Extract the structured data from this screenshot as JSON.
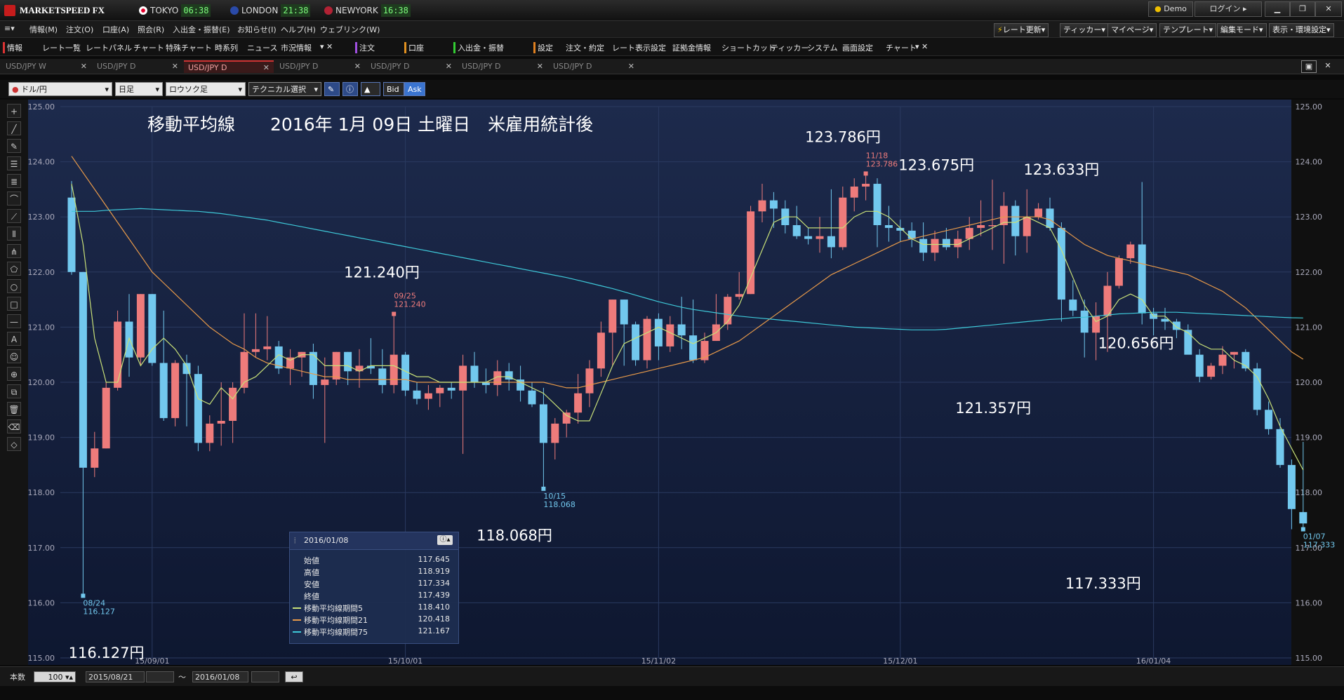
{
  "app": {
    "title": "MARKETSPEED FX"
  },
  "clocks": [
    {
      "city": "TOKYO",
      "time": "06:38",
      "flag": "#e4002b"
    },
    {
      "city": "LONDON",
      "time": "21:38",
      "flag": "#2a4aa8"
    },
    {
      "city": "NEWYORK",
      "time": "16:38",
      "flag": "#b22234"
    }
  ],
  "window": {
    "demo_label": "Demo",
    "login_label": "ログイン"
  },
  "menu": [
    "情報(M)",
    "注文(O)",
    "口座(A)",
    "照会(R)",
    "入出金・振替(E)",
    "お知らせ(I)",
    "ヘルプ(H)",
    "ウェブリンク(W)"
  ],
  "right_buttons": [
    "レート更新",
    "ティッカー",
    "マイページ",
    "テンプレート",
    "編集モード",
    "表示・環境設定"
  ],
  "toolbar": {
    "info_label": "情報",
    "info_items": [
      "レート一覧",
      "レートパネル",
      "チャート",
      "特殊チャート",
      "時系列",
      "ニュース",
      "市況情報"
    ],
    "order_label": "注文",
    "account_label": "口座",
    "deposit_label": "入出金・振替",
    "settings_label": "設定",
    "settings_items": [
      "注文・約定",
      "レート表示設定",
      "証拠金情報",
      "ショートカット",
      "ティッカー",
      "システム",
      "画面設定",
      "チャート"
    ]
  },
  "tabs": [
    "USD/JPY W",
    "USD/JPY D",
    "USD/JPY D",
    "USD/JPY D",
    "USD/JPY D",
    "USD/JPY D",
    "USD/JPY D"
  ],
  "active_tab": 2,
  "chart_controls": {
    "pair": "ドル/円",
    "period": "日足",
    "chart_type": "ロウソク足",
    "technical": "テクニカル選択",
    "bid": "Bid",
    "ask": "Ask"
  },
  "left_tools": [
    "crosshair",
    "trend-line",
    "pencil",
    "horizontal-lines",
    "channel-lines",
    "arc",
    "fibonacci-fan",
    "vertical-lines",
    "pitchfork",
    "pentagon",
    "circle",
    "rectangle",
    "horizontal-line",
    "text",
    "icon",
    "zoom",
    "copy",
    "trash",
    "erase",
    "tag"
  ],
  "footer": {
    "count_label": "本数",
    "count": "100",
    "from": "2015/08/21",
    "tilde": "〜",
    "to": "2016/01/08"
  },
  "chart_data": {
    "type": "candlestick",
    "title": "移動平均線　　2016年 1月 09日 土曜日　米雇用統計後",
    "ylim": [
      115.0,
      125.0
    ],
    "yticks": [
      "125.00",
      "124.00",
      "123.00",
      "122.00",
      "121.00",
      "120.00",
      "119.00",
      "118.00",
      "117.00",
      "116.00",
      "115.00"
    ],
    "x_date_labels": [
      {
        "i": 7,
        "label": "15/09/01"
      },
      {
        "i": 29,
        "label": "15/10/01"
      },
      {
        "i": 51,
        "label": "15/11/02"
      },
      {
        "i": 72,
        "label": "15/12/01"
      },
      {
        "i": 94,
        "label": "16/01/04"
      }
    ],
    "up_color": "#ee7b7b",
    "down_color": "#72c8ee",
    "candles": [
      [
        123.35,
        123.65,
        121.95,
        122.0
      ],
      [
        122.0,
        122.0,
        116.127,
        118.45
      ],
      [
        118.45,
        119.1,
        118.28,
        118.8
      ],
      [
        118.8,
        120.0,
        118.8,
        119.9
      ],
      [
        119.9,
        121.3,
        119.85,
        121.1
      ],
      [
        121.1,
        121.6,
        120.1,
        120.45
      ],
      [
        120.45,
        121.6,
        120.3,
        121.6
      ],
      [
        121.6,
        121.6,
        120.3,
        120.35
      ],
      [
        120.35,
        121.3,
        119.3,
        119.35
      ],
      [
        119.35,
        120.4,
        119.2,
        120.35
      ],
      [
        120.35,
        120.5,
        119.2,
        120.15
      ],
      [
        120.15,
        120.3,
        118.75,
        118.9
      ],
      [
        118.9,
        119.4,
        118.75,
        119.25
      ],
      [
        119.25,
        120.0,
        118.85,
        119.3
      ],
      [
        119.3,
        120.0,
        118.9,
        119.9
      ],
      [
        119.9,
        121.25,
        119.8,
        120.55
      ],
      [
        120.55,
        121.25,
        120.45,
        120.6
      ],
      [
        120.6,
        121.2,
        120.4,
        120.65
      ],
      [
        120.65,
        120.75,
        120.15,
        120.25
      ],
      [
        120.25,
        120.6,
        119.95,
        120.45
      ],
      [
        120.45,
        120.55,
        120.1,
        120.55
      ],
      [
        120.55,
        120.7,
        119.7,
        119.95
      ],
      [
        119.95,
        120.45,
        118.9,
        120.05
      ],
      [
        120.05,
        120.55,
        119.95,
        120.55
      ],
      [
        120.55,
        120.55,
        119.95,
        120.2
      ],
      [
        120.2,
        120.6,
        119.9,
        120.3
      ],
      [
        120.3,
        120.8,
        120.15,
        120.25
      ],
      [
        120.25,
        120.6,
        119.8,
        119.95
      ],
      [
        119.95,
        121.24,
        119.8,
        120.5
      ],
      [
        120.5,
        120.55,
        119.75,
        119.85
      ],
      [
        119.85,
        120.0,
        119.6,
        119.7
      ],
      [
        119.7,
        119.95,
        119.5,
        119.8
      ],
      [
        119.8,
        119.95,
        119.55,
        119.9
      ],
      [
        119.9,
        120.0,
        119.7,
        119.85
      ],
      [
        119.85,
        120.5,
        118.7,
        120.3
      ],
      [
        120.3,
        120.55,
        119.9,
        120.0
      ],
      [
        120.0,
        120.25,
        119.8,
        119.95
      ],
      [
        119.95,
        120.4,
        119.75,
        120.2
      ],
      [
        120.2,
        120.35,
        119.85,
        120.05
      ],
      [
        120.05,
        120.3,
        119.65,
        119.85
      ],
      [
        119.85,
        120.0,
        119.55,
        119.6
      ],
      [
        119.6,
        119.9,
        118.068,
        118.9
      ],
      [
        118.9,
        119.35,
        118.6,
        119.25
      ],
      [
        119.25,
        119.5,
        119.0,
        119.45
      ],
      [
        119.45,
        120.15,
        119.25,
        119.8
      ],
      [
        119.8,
        120.4,
        119.55,
        120.25
      ],
      [
        120.25,
        121.1,
        120.1,
        120.9
      ],
      [
        120.9,
        121.5,
        120.3,
        121.5
      ],
      [
        121.5,
        121.5,
        120.3,
        121.05
      ],
      [
        121.05,
        121.1,
        120.3,
        120.4
      ],
      [
        120.4,
        121.2,
        120.25,
        121.15
      ],
      [
        121.15,
        121.25,
        120.4,
        120.65
      ],
      [
        120.65,
        121.2,
        120.55,
        121.05
      ],
      [
        121.05,
        121.55,
        120.6,
        120.85
      ],
      [
        120.85,
        121.5,
        120.35,
        120.4
      ],
      [
        120.4,
        120.9,
        120.35,
        120.75
      ],
      [
        120.75,
        121.6,
        120.75,
        121.05
      ],
      [
        121.05,
        121.6,
        120.95,
        121.55
      ],
      [
        121.55,
        122.0,
        121.5,
        121.6
      ],
      [
        121.6,
        123.2,
        121.6,
        123.1
      ],
      [
        123.1,
        123.6,
        122.9,
        123.3
      ],
      [
        123.3,
        123.45,
        122.8,
        123.15
      ],
      [
        123.15,
        123.3,
        122.7,
        122.85
      ],
      [
        122.85,
        123.2,
        122.6,
        122.65
      ],
      [
        122.65,
        122.8,
        122.5,
        122.6
      ],
      [
        122.6,
        123.0,
        122.35,
        122.65
      ],
      [
        122.65,
        123.5,
        122.25,
        122.45
      ],
      [
        122.45,
        123.55,
        122.4,
        123.35
      ],
      [
        123.35,
        123.7,
        123.1,
        123.55
      ],
      [
        123.55,
        123.786,
        123.3,
        123.6
      ],
      [
        123.6,
        123.7,
        122.45,
        122.85
      ],
      [
        122.85,
        123.2,
        122.55,
        122.8
      ],
      [
        122.8,
        122.95,
        122.55,
        122.75
      ],
      [
        122.75,
        122.9,
        122.45,
        122.6
      ],
      [
        122.6,
        122.9,
        122.2,
        122.35
      ],
      [
        122.35,
        122.75,
        122.2,
        122.6
      ],
      [
        122.6,
        122.8,
        122.4,
        122.45
      ],
      [
        122.45,
        122.75,
        122.25,
        122.6
      ],
      [
        122.6,
        123.0,
        122.4,
        122.8
      ],
      [
        122.8,
        123.3,
        122.65,
        122.85
      ],
      [
        122.85,
        123.675,
        122.4,
        122.85
      ],
      [
        122.85,
        123.45,
        122.15,
        123.2
      ],
      [
        123.2,
        123.3,
        122.3,
        122.65
      ],
      [
        122.65,
        123.5,
        122.35,
        123.0
      ],
      [
        123.0,
        123.25,
        122.95,
        123.15
      ],
      [
        123.15,
        123.35,
        122.75,
        122.8
      ],
      [
        122.8,
        122.9,
        121.1,
        121.5
      ],
      [
        121.5,
        121.85,
        121.2,
        121.3
      ],
      [
        121.3,
        121.5,
        120.45,
        120.9
      ],
      [
        120.9,
        121.45,
        120.4,
        121.2
      ],
      [
        121.2,
        122.0,
        120.55,
        121.75
      ],
      [
        121.75,
        122.3,
        121.7,
        122.25
      ],
      [
        122.25,
        122.55,
        122.15,
        122.5
      ],
      [
        122.5,
        123.633,
        121.05,
        121.25
      ],
      [
        121.25,
        121.35,
        120.85,
        121.15
      ],
      [
        121.15,
        121.35,
        120.95,
        121.1
      ],
      [
        121.1,
        121.15,
        120.8,
        120.95
      ],
      [
        120.95,
        121.05,
        120.55,
        120.5
      ],
      [
        120.5,
        120.6,
        120.0,
        120.1
      ],
      [
        120.1,
        120.35,
        120.05,
        120.3
      ],
      [
        120.3,
        120.656,
        120.15,
        120.5
      ],
      [
        120.5,
        120.55,
        120.25,
        120.55
      ],
      [
        120.55,
        120.6,
        120.2,
        120.25
      ],
      [
        120.25,
        120.35,
        119.4,
        119.5
      ],
      [
        119.5,
        119.65,
        119.05,
        119.15
      ],
      [
        119.15,
        119.35,
        118.45,
        118.5
      ],
      [
        118.5,
        118.6,
        117.334,
        117.7
      ],
      [
        117.645,
        118.919,
        117.334,
        117.439
      ]
    ],
    "ma5": [
      123.6,
      122.5,
      120.8,
      120.0,
      120.0,
      120.8,
      120.3,
      120.6,
      120.8,
      120.6,
      120.3,
      119.7,
      119.6,
      119.9,
      119.7,
      120.0,
      120.1,
      120.3,
      120.5,
      120.4,
      120.5,
      120.5,
      120.3,
      120.3,
      120.3,
      120.2,
      120.3,
      120.3,
      120.3,
      120.2,
      120.1,
      120.1,
      120.0,
      120.0,
      120.0,
      120.0,
      120.0,
      120.1,
      120.1,
      120.0,
      119.9,
      119.8,
      119.6,
      119.4,
      119.3,
      119.3,
      119.8,
      120.3,
      120.7,
      120.8,
      120.9,
      121.0,
      120.9,
      120.8,
      120.7,
      120.8,
      120.9,
      121.1,
      121.4,
      121.9,
      122.4,
      122.9,
      123.0,
      123.0,
      122.8,
      122.8,
      122.8,
      122.8,
      123.0,
      123.1,
      123.1,
      123.0,
      122.8,
      122.6,
      122.5,
      122.5,
      122.5,
      122.5,
      122.6,
      122.7,
      122.8,
      122.9,
      122.9,
      123.0,
      122.9,
      122.8,
      122.4,
      121.9,
      121.4,
      121.1,
      121.2,
      121.5,
      121.6,
      121.5,
      121.2,
      121.2,
      121.0,
      120.9,
      120.7,
      120.6,
      120.6,
      120.4,
      120.3,
      120.1,
      119.7,
      119.2,
      118.8,
      118.41
    ],
    "ma21": [
      124.1,
      123.8,
      123.5,
      123.2,
      122.9,
      122.6,
      122.3,
      122.0,
      121.8,
      121.6,
      121.4,
      121.2,
      121.0,
      120.85,
      120.7,
      120.6,
      120.45,
      120.35,
      120.3,
      120.25,
      120.2,
      120.15,
      120.1,
      120.1,
      120.05,
      120.05,
      120.05,
      120.05,
      120.05,
      120.05,
      120.0,
      120.0,
      120.0,
      120.0,
      120.0,
      120.0,
      120.0,
      120.0,
      120.0,
      120.0,
      120.0,
      120.0,
      119.95,
      119.9,
      119.9,
      119.95,
      120.0,
      120.05,
      120.1,
      120.15,
      120.2,
      120.25,
      120.3,
      120.35,
      120.4,
      120.45,
      120.55,
      120.65,
      120.75,
      120.9,
      121.05,
      121.2,
      121.35,
      121.5,
      121.65,
      121.8,
      121.95,
      122.05,
      122.15,
      122.25,
      122.35,
      122.45,
      122.55,
      122.6,
      122.65,
      122.7,
      122.75,
      122.8,
      122.85,
      122.9,
      122.95,
      123.0,
      123.0,
      123.0,
      123.0,
      122.95,
      122.8,
      122.65,
      122.5,
      122.4,
      122.3,
      122.25,
      122.2,
      122.15,
      122.1,
      122.05,
      122.0,
      121.95,
      121.85,
      121.75,
      121.65,
      121.5,
      121.35,
      121.15,
      120.95,
      120.75,
      120.55,
      120.418
    ],
    "ma75": [
      123.1,
      123.1,
      123.1,
      123.12,
      123.13,
      123.14,
      123.15,
      123.14,
      123.13,
      123.12,
      123.11,
      123.1,
      123.08,
      123.06,
      123.03,
      123.0,
      122.97,
      122.94,
      122.9,
      122.86,
      122.82,
      122.78,
      122.74,
      122.7,
      122.66,
      122.62,
      122.58,
      122.54,
      122.5,
      122.46,
      122.42,
      122.38,
      122.34,
      122.3,
      122.26,
      122.22,
      122.18,
      122.14,
      122.1,
      122.06,
      122.02,
      121.98,
      121.94,
      121.9,
      121.85,
      121.8,
      121.75,
      121.7,
      121.64,
      121.58,
      121.52,
      121.46,
      121.41,
      121.36,
      121.32,
      121.29,
      121.26,
      121.23,
      121.2,
      121.18,
      121.16,
      121.14,
      121.12,
      121.1,
      121.08,
      121.06,
      121.04,
      121.02,
      121.0,
      120.99,
      120.98,
      120.97,
      120.96,
      120.95,
      120.95,
      120.95,
      120.96,
      120.98,
      121.0,
      121.02,
      121.04,
      121.06,
      121.08,
      121.1,
      121.12,
      121.14,
      121.15,
      121.17,
      121.18,
      121.2,
      121.22,
      121.24,
      121.25,
      121.26,
      121.27,
      121.27,
      121.27,
      121.26,
      121.25,
      121.24,
      121.23,
      121.22,
      121.21,
      121.2,
      121.19,
      121.18,
      121.17,
      121.167
    ],
    "markers": [
      {
        "i": 1,
        "date": "08/24",
        "price": "116.127",
        "pos": "below"
      },
      {
        "i": 28,
        "date": "09/25",
        "price": "121.240",
        "pos": "above"
      },
      {
        "i": 41,
        "date": "10/15",
        "price": "118.068",
        "pos": "below"
      },
      {
        "i": 69,
        "date": "11/18",
        "price": "123.786",
        "pos": "above"
      },
      {
        "i": 107,
        "date": "01/07",
        "price": "117.333",
        "pos": "below"
      }
    ],
    "annotations": [
      {
        "text": "123.786円",
        "cx": 0.645,
        "cy": 0.05
      },
      {
        "text": "123.675円",
        "cx": 0.719,
        "cy": 0.1
      },
      {
        "text": "123.633円",
        "cx": 0.818,
        "cy": 0.108
      },
      {
        "text": "121.240円",
        "cx": 0.28,
        "cy": 0.29
      },
      {
        "text": "120.656円",
        "cx": 0.877,
        "cy": 0.415
      },
      {
        "text": "121.357円",
        "cx": 0.764,
        "cy": 0.53
      },
      {
        "text": "118.068円",
        "cx": 0.385,
        "cy": 0.755
      },
      {
        "text": "117.333円",
        "cx": 0.851,
        "cy": 0.84
      },
      {
        "text": "116.127円",
        "cx": 0.062,
        "cy": 0.963
      }
    ],
    "series": [
      {
        "name": "移動平均線期間5",
        "color": "#c8e078"
      },
      {
        "name": "移動平均線期間21",
        "color": "#e89a4a"
      },
      {
        "name": "移動平均線期間75",
        "color": "#3ec8d8"
      }
    ],
    "info": {
      "date": "2016/01/08",
      "rows": [
        [
          "始値",
          "117.645"
        ],
        [
          "高値",
          "118.919"
        ],
        [
          "安値",
          "117.334"
        ],
        [
          "終値",
          "117.439"
        ],
        [
          "移動平均線期間5",
          "118.410"
        ],
        [
          "移動平均線期間21",
          "120.418"
        ],
        [
          "移動平均線期間75",
          "121.167"
        ]
      ]
    }
  }
}
